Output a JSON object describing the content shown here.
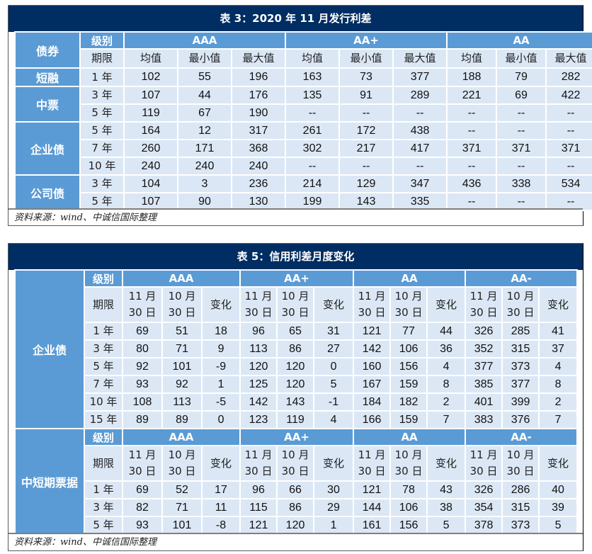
{
  "table3": {
    "title": "表 3：2020 年 11 月发行利差",
    "header": {
      "bond_label": "债券",
      "grade_label": "级别",
      "term_label": "期限",
      "grades": [
        "AAA",
        "AA+",
        "AA"
      ],
      "metrics": [
        "均值",
        "最小值",
        "最大值"
      ]
    },
    "groups": [
      {
        "name": "短融",
        "rows": [
          {
            "term": "1 年",
            "values": [
              "102",
              "55",
              "196",
              "163",
              "73",
              "377",
              "188",
              "79",
              "282"
            ]
          }
        ]
      },
      {
        "name": "中票",
        "rows": [
          {
            "term": "3 年",
            "values": [
              "107",
              "44",
              "176",
              "135",
              "91",
              "289",
              "221",
              "69",
              "422"
            ]
          },
          {
            "term": "5 年",
            "values": [
              "119",
              "67",
              "190",
              "--",
              "--",
              "--",
              "--",
              "--",
              "--"
            ]
          }
        ]
      },
      {
        "name": "企业债",
        "rows": [
          {
            "term": "5 年",
            "values": [
              "164",
              "12",
              "317",
              "261",
              "172",
              "438",
              "--",
              "--",
              "--"
            ]
          },
          {
            "term": "7 年",
            "values": [
              "260",
              "171",
              "368",
              "302",
              "217",
              "417",
              "371",
              "371",
              "371"
            ]
          },
          {
            "term": "10 年",
            "values": [
              "240",
              "240",
              "240",
              "--",
              "--",
              "--",
              "--",
              "--",
              "--"
            ]
          }
        ]
      },
      {
        "name": "公司债",
        "rows": [
          {
            "term": "3 年",
            "values": [
              "104",
              "3",
              "236",
              "214",
              "129",
              "347",
              "436",
              "338",
              "534"
            ]
          },
          {
            "term": "5 年",
            "values": [
              "107",
              "90",
              "130",
              "199",
              "143",
              "335",
              "--",
              "--",
              "--"
            ]
          }
        ]
      }
    ],
    "source": "资料来源：wind、中诚信国际整理"
  },
  "table5": {
    "title": "表 5：信用利差月度变化",
    "header": {
      "grade_label": "级别",
      "term_label": "期限",
      "grades": [
        "AAA",
        "AA+",
        "AA",
        "AA-"
      ],
      "col_nov_l1": "11 月",
      "col_nov_l2": "30 日",
      "col_oct_l1": "10 月",
      "col_oct_l2": "30 日",
      "col_change": "变化"
    },
    "sections": [
      {
        "name": "企业债",
        "rows": [
          {
            "term": "1 年",
            "values": [
              "69",
              "51",
              "18",
              "96",
              "65",
              "31",
              "121",
              "77",
              "44",
              "326",
              "285",
              "41"
            ]
          },
          {
            "term": "3 年",
            "values": [
              "80",
              "71",
              "9",
              "113",
              "86",
              "27",
              "142",
              "106",
              "36",
              "352",
              "315",
              "37"
            ]
          },
          {
            "term": "5 年",
            "values": [
              "92",
              "101",
              "-9",
              "120",
              "120",
              "0",
              "160",
              "156",
              "4",
              "377",
              "373",
              "4"
            ]
          },
          {
            "term": "7 年",
            "values": [
              "93",
              "92",
              "1",
              "125",
              "120",
              "5",
              "167",
              "159",
              "8",
              "385",
              "377",
              "8"
            ]
          },
          {
            "term": "10 年",
            "values": [
              "108",
              "113",
              "-5",
              "142",
              "143",
              "-1",
              "184",
              "182",
              "2",
              "401",
              "399",
              "2"
            ]
          },
          {
            "term": "15 年",
            "values": [
              "89",
              "89",
              "0",
              "123",
              "119",
              "4",
              "166",
              "159",
              "7",
              "383",
              "376",
              "7"
            ]
          }
        ]
      },
      {
        "name": "中短期票据",
        "rows": [
          {
            "term": "1 年",
            "values": [
              "69",
              "52",
              "17",
              "96",
              "66",
              "30",
              "121",
              "78",
              "43",
              "326",
              "286",
              "40"
            ]
          },
          {
            "term": "3 年",
            "values": [
              "82",
              "71",
              "11",
              "115",
              "86",
              "29",
              "144",
              "106",
              "38",
              "354",
              "315",
              "39"
            ]
          },
          {
            "term": "5 年",
            "values": [
              "93",
              "101",
              "-8",
              "121",
              "120",
              "1",
              "161",
              "156",
              "5",
              "378",
              "373",
              "5"
            ]
          }
        ]
      }
    ],
    "source": "资料来源：wind、中诚信国际整理"
  }
}
